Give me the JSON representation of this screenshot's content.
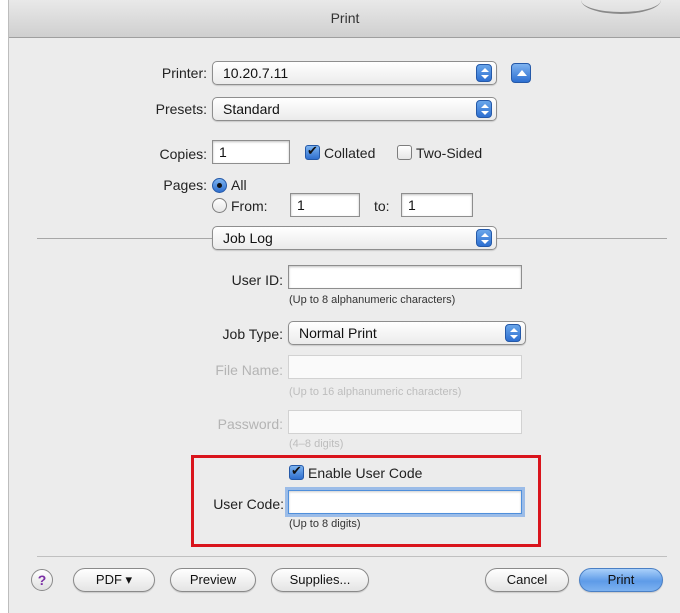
{
  "window": {
    "title": "Print"
  },
  "printer": {
    "label": "Printer:",
    "value": "10.20.7.11"
  },
  "presets": {
    "label": "Presets:",
    "value": "Standard"
  },
  "copies": {
    "label": "Copies:",
    "value": "1",
    "collated_label": "Collated",
    "collated_checked": true,
    "two_sided_label": "Two-Sided",
    "two_sided_checked": false
  },
  "pages": {
    "label": "Pages:",
    "all_label": "All",
    "from_label": "From:",
    "from_value": "1",
    "to_label": "to:",
    "to_value": "1",
    "selected": "All"
  },
  "section": {
    "value": "Job Log"
  },
  "user_id": {
    "label": "User ID:",
    "value": "",
    "hint": "(Up to 8 alphanumeric characters)"
  },
  "job_type": {
    "label": "Job Type:",
    "value": "Normal Print"
  },
  "file_name": {
    "label": "File Name:",
    "value": "",
    "hint": "(Up to 16 alphanumeric characters)"
  },
  "password": {
    "label": "Password:",
    "value": "",
    "hint": "(4–8 digits)"
  },
  "user_code": {
    "enable_label": "Enable User Code",
    "enable_checked": true,
    "label": "User Code:",
    "value": "",
    "hint": "(Up to 8 digits)"
  },
  "footer": {
    "help": "?",
    "pdf_label": "PDF ▾",
    "preview_label": "Preview",
    "supplies_label": "Supplies...",
    "cancel_label": "Cancel",
    "print_label": "Print"
  },
  "colors": {
    "highlight": "#d9141c",
    "accent": "#2d6fd1"
  }
}
